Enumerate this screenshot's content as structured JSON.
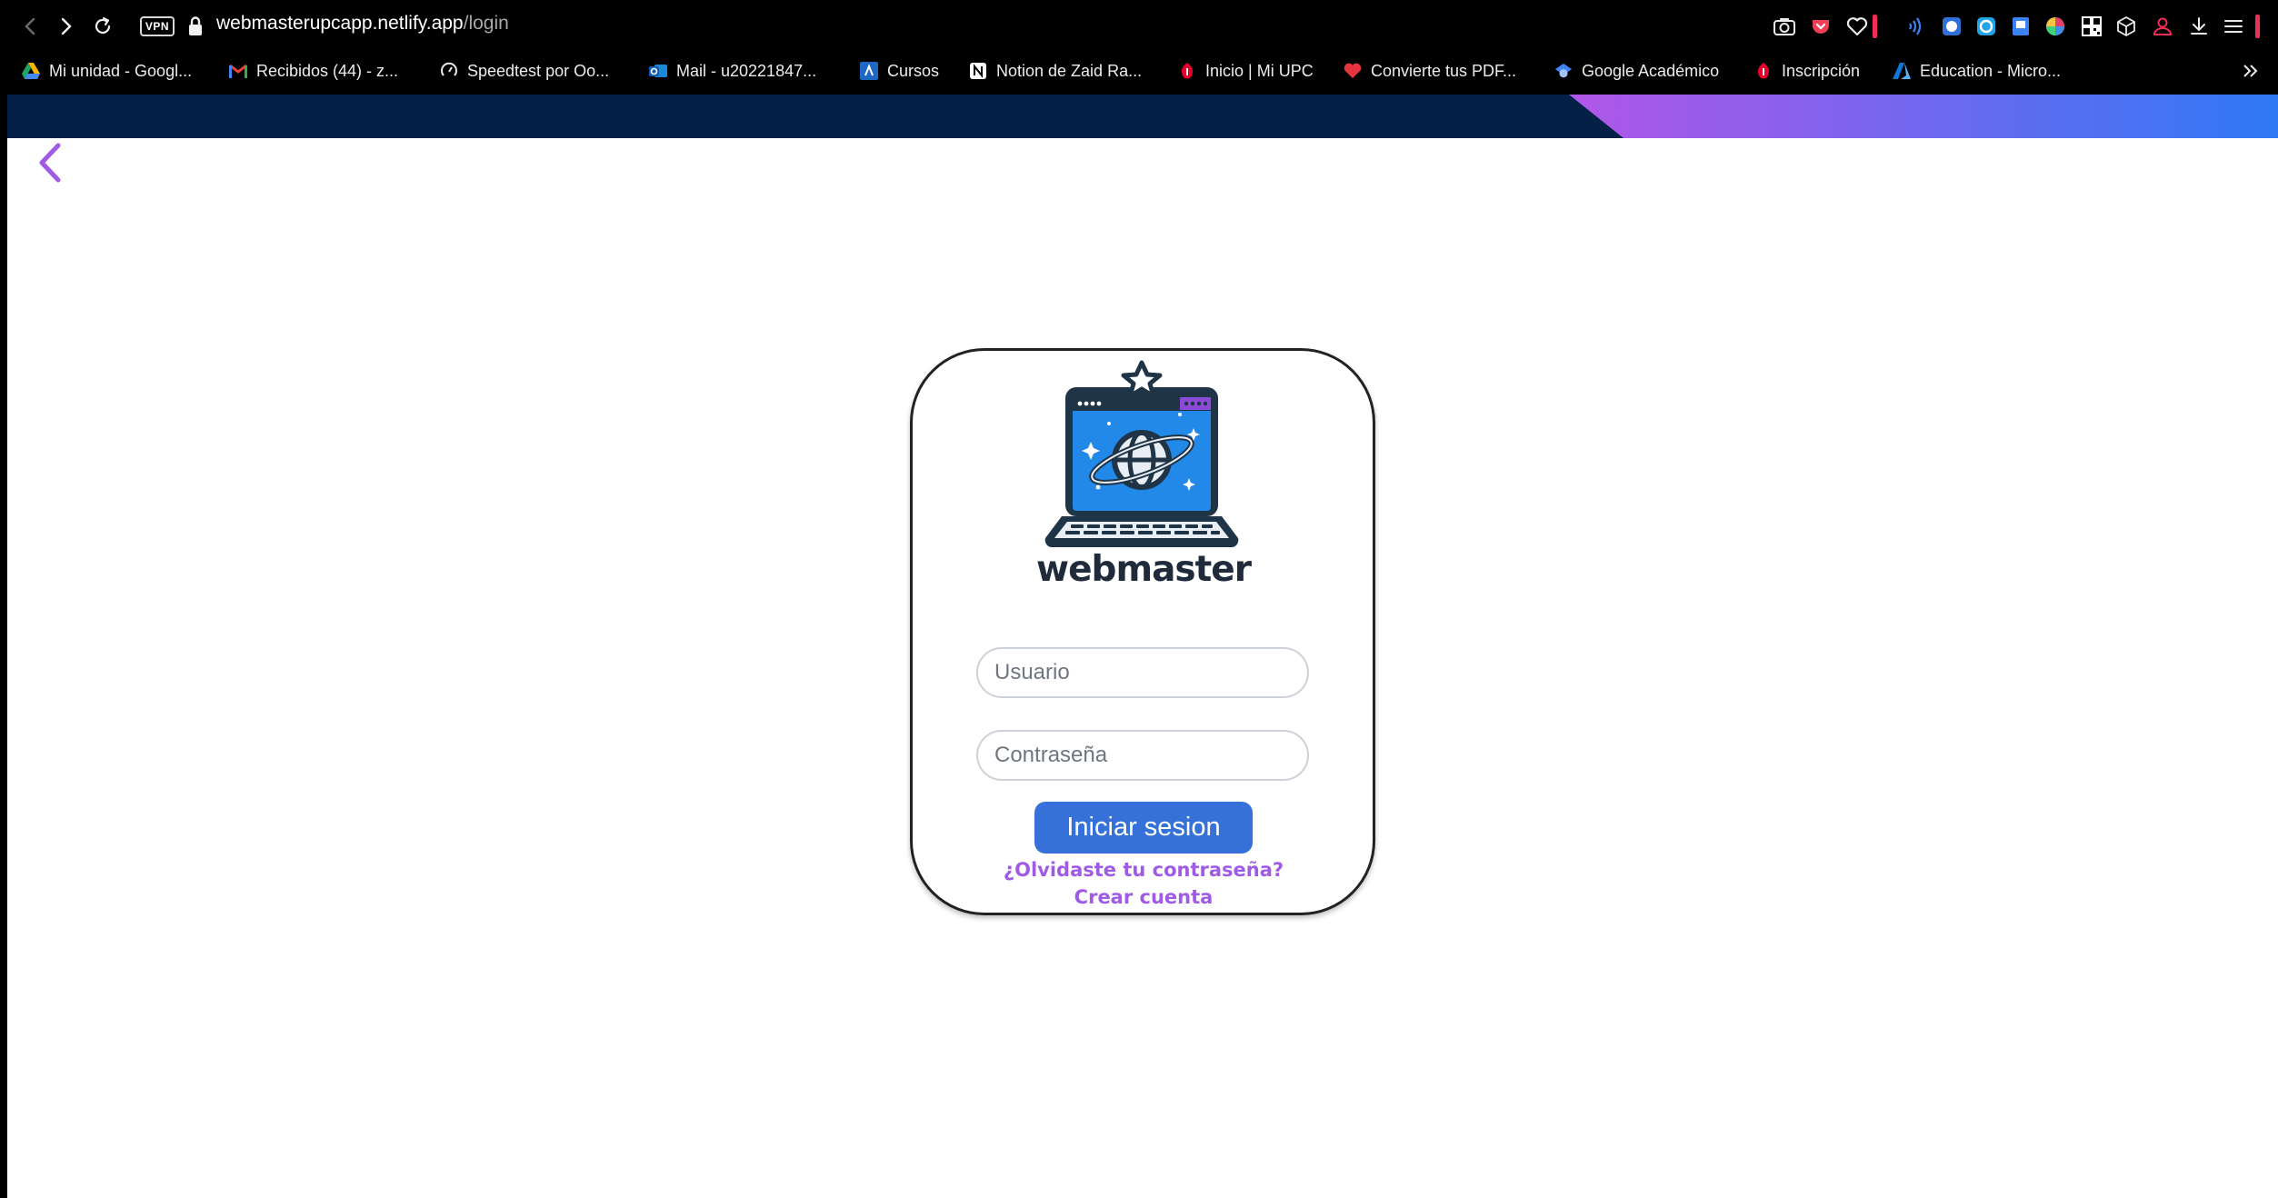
{
  "browser": {
    "vpn_label": "VPN",
    "url_host": "webmasterupcapp.netlify.app",
    "url_path": "/login",
    "bookmarks": [
      {
        "label": "Mi unidad - Googl...",
        "icon": "google-drive-icon"
      },
      {
        "label": "Recibidos (44) - z...",
        "icon": "gmail-icon"
      },
      {
        "label": "Speedtest por Oo...",
        "icon": "speedtest-icon"
      },
      {
        "label": "Mail - u20221847...",
        "icon": "outlook-icon"
      },
      {
        "label": "Cursos",
        "icon": "canvas-icon"
      },
      {
        "label": "Notion de Zaid Ra...",
        "icon": "notion-icon"
      },
      {
        "label": "Inicio | Mi UPC",
        "icon": "upc-icon"
      },
      {
        "label": "Convierte tus PDF...",
        "icon": "heart-pdf-icon"
      },
      {
        "label": "Google Académico",
        "icon": "google-scholar-icon"
      },
      {
        "label": "Inscripción",
        "icon": "upc-icon"
      },
      {
        "label": "Education - Micro...",
        "icon": "azure-icon"
      }
    ],
    "more_bookmarks_icon": "double-chevron-icon"
  },
  "site": {
    "brand": "webmaster",
    "logo_icon": "laptop-globe-star-icon"
  },
  "login": {
    "username_placeholder": "Usuario",
    "password_placeholder": "Contraseña",
    "submit_label": "Iniciar sesion",
    "forgot_link": "¿Olvidaste tu contraseña?",
    "create_link": "Crear cuenta"
  },
  "colors": {
    "header_bg": "#042046",
    "gradient_start": "#b256e8",
    "gradient_end": "#2f79f5",
    "button_bg": "#3571d9",
    "link_color": "#a05be6",
    "back_arrow": "#a05be6"
  }
}
